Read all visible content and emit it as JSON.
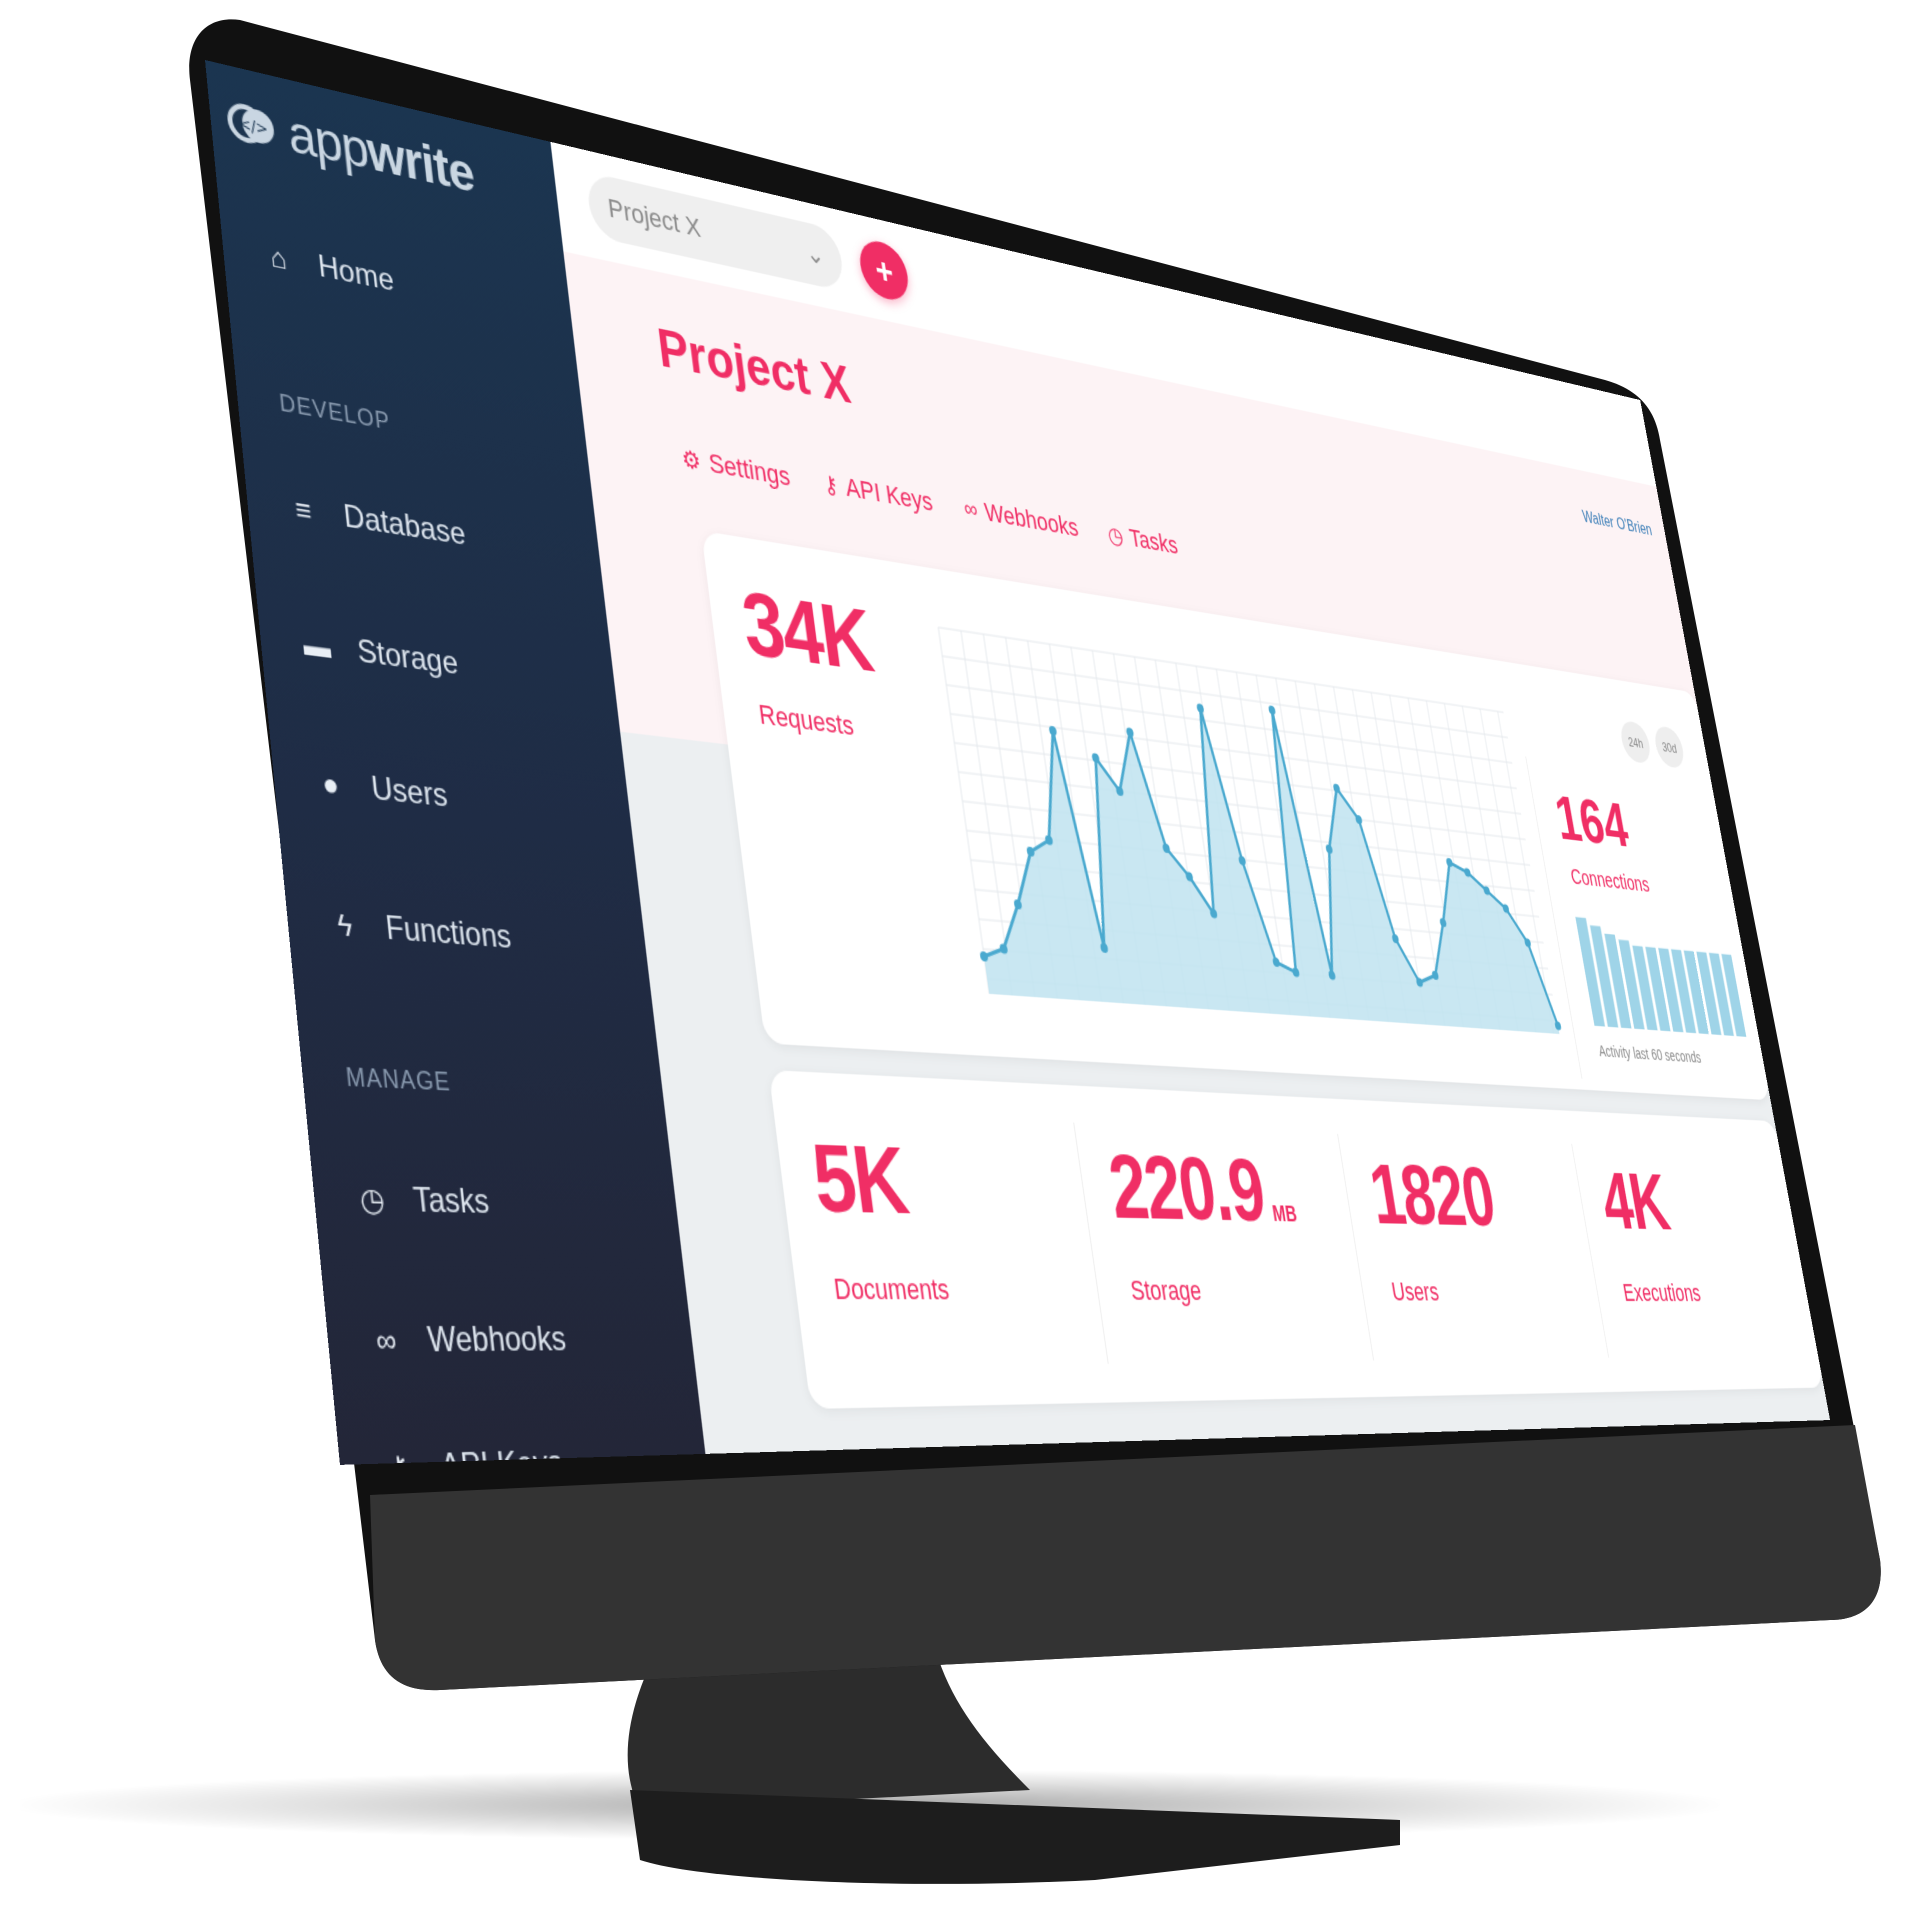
{
  "brand": {
    "logo_prefix": "app",
    "logo_suffix": "write",
    "accent": "#f02e65"
  },
  "sidebar": {
    "home": {
      "label": "Home",
      "icon": "home-icon"
    },
    "develop_label": "DEVELOP",
    "develop_items": [
      {
        "label": "Database",
        "icon": "database-icon"
      },
      {
        "label": "Storage",
        "icon": "folder-icon"
      },
      {
        "label": "Users",
        "icon": "users-icon"
      },
      {
        "label": "Functions",
        "icon": "bolt-icon"
      }
    ],
    "manage_label": "MANAGE",
    "manage_items": [
      {
        "label": "Tasks",
        "icon": "clock-icon"
      },
      {
        "label": "Webhooks",
        "icon": "link-icon"
      },
      {
        "label": "API Keys",
        "icon": "key-icon"
      }
    ]
  },
  "topbar": {
    "project_select_value": "Project X",
    "add_label": "+"
  },
  "header": {
    "title": "Project X",
    "user": "Walter O'Brien",
    "tabs": [
      {
        "label": "Settings",
        "icon": "gear-icon"
      },
      {
        "label": "API Keys",
        "icon": "key-icon"
      },
      {
        "label": "Webhooks",
        "icon": "link-icon"
      },
      {
        "label": "Tasks",
        "icon": "clock-icon"
      }
    ]
  },
  "requests": {
    "value": "34K",
    "label": "Requests",
    "periods": [
      "24h",
      "30d"
    ]
  },
  "connections": {
    "value": "164",
    "label": "Connections",
    "activity_label": "Activity last 60 seconds",
    "bars": [
      0.92,
      0.86,
      0.8,
      0.76,
      0.72,
      0.72,
      0.72,
      0.72,
      0.72,
      0.72,
      0.72,
      0.72
    ]
  },
  "stats": [
    {
      "value": "5K",
      "unit": "",
      "label": "Documents"
    },
    {
      "value": "220.9",
      "unit": "MB",
      "label": "Storage"
    },
    {
      "value": "1820",
      "unit": "",
      "label": "Users"
    },
    {
      "value": "4K",
      "unit": "",
      "label": "Executions"
    }
  ],
  "chart_data": {
    "type": "area",
    "title": "",
    "xlabel": "",
    "ylabel": "",
    "x": [
      0,
      1,
      2,
      3,
      4,
      5,
      6,
      7,
      8,
      9,
      10,
      11,
      12,
      13,
      14,
      15,
      16,
      17,
      18,
      19,
      20,
      21,
      22,
      23,
      24,
      25,
      26,
      27,
      28,
      29,
      30,
      31
    ],
    "series": [
      {
        "values": [
          8,
          10,
          20,
          32,
          35,
          60,
          12,
          55,
          48,
          62,
          36,
          30,
          22,
          70,
          35,
          12,
          10,
          72,
          10,
          40,
          55,
          48,
          20,
          10,
          12,
          25,
          40,
          38,
          34,
          30,
          22,
          2
        ]
      }
    ],
    "ylim": [
      0,
      80
    ],
    "grid": true,
    "colors": {
      "line": "#4aa9cf",
      "fill": "#bfe3f0"
    }
  }
}
